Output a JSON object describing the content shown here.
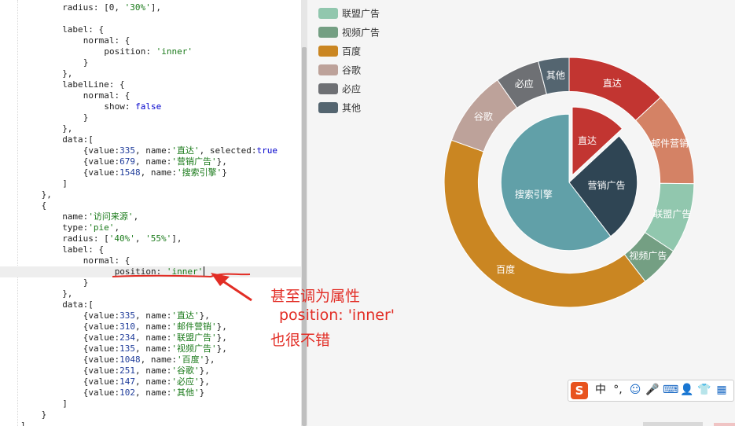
{
  "editor": {
    "lines": [
      {
        "indent": 8,
        "parts": [
          [
            "",
            "radius: [0, "
          ],
          [
            "str",
            "'30%'"
          ],
          [
            "",
            "],"
          ]
        ]
      },
      {
        "indent": 0,
        "parts": []
      },
      {
        "indent": 8,
        "parts": [
          [
            "",
            "label: {"
          ]
        ]
      },
      {
        "indent": 12,
        "parts": [
          [
            "",
            "normal: {"
          ]
        ]
      },
      {
        "indent": 16,
        "parts": [
          [
            "",
            "position: "
          ],
          [
            "str",
            "'inner'"
          ]
        ]
      },
      {
        "indent": 12,
        "parts": [
          [
            "",
            "}"
          ]
        ]
      },
      {
        "indent": 8,
        "parts": [
          [
            "",
            "},"
          ]
        ]
      },
      {
        "indent": 8,
        "parts": [
          [
            "",
            "labelLine: {"
          ]
        ]
      },
      {
        "indent": 12,
        "parts": [
          [
            "",
            "normal: {"
          ]
        ]
      },
      {
        "indent": 16,
        "parts": [
          [
            "",
            "show: "
          ],
          [
            "kw",
            "false"
          ]
        ]
      },
      {
        "indent": 12,
        "parts": [
          [
            "",
            "}"
          ]
        ]
      },
      {
        "indent": 8,
        "parts": [
          [
            "",
            "},"
          ]
        ]
      },
      {
        "indent": 8,
        "parts": [
          [
            "",
            "data:["
          ]
        ]
      },
      {
        "indent": 12,
        "parts": [
          [
            "",
            "{value:"
          ],
          [
            "num",
            "335"
          ],
          [
            "",
            ", name:"
          ],
          [
            "str",
            "'直达'"
          ],
          [
            "",
            ", selected:"
          ],
          [
            "kw",
            "true"
          ]
        ]
      },
      {
        "indent": 12,
        "parts": [
          [
            "",
            "{value:"
          ],
          [
            "num",
            "679"
          ],
          [
            "",
            ", name:"
          ],
          [
            "str",
            "'营销广告'"
          ],
          [
            "",
            "},"
          ]
        ]
      },
      {
        "indent": 12,
        "parts": [
          [
            "",
            "{value:"
          ],
          [
            "num",
            "1548"
          ],
          [
            "",
            ", name:"
          ],
          [
            "str",
            "'搜索引擎'"
          ],
          [
            "",
            "}"
          ]
        ]
      },
      {
        "indent": 8,
        "parts": [
          [
            "",
            "]"
          ]
        ]
      },
      {
        "indent": 4,
        "parts": [
          [
            "",
            "},"
          ]
        ]
      },
      {
        "indent": 4,
        "parts": [
          [
            "",
            "{"
          ]
        ]
      },
      {
        "indent": 8,
        "parts": [
          [
            "",
            "name:"
          ],
          [
            "str",
            "'访问来源'"
          ],
          [
            "",
            ","
          ]
        ]
      },
      {
        "indent": 8,
        "parts": [
          [
            "",
            "type:"
          ],
          [
            "str",
            "'pie'"
          ],
          [
            "",
            ","
          ]
        ]
      },
      {
        "indent": 8,
        "parts": [
          [
            "",
            "radius: ["
          ],
          [
            "str",
            "'40%'"
          ],
          [
            "",
            ", "
          ],
          [
            "str",
            "'55%'"
          ],
          [
            "",
            "],"
          ]
        ]
      },
      {
        "indent": 8,
        "parts": [
          [
            "",
            "label: {"
          ]
        ]
      },
      {
        "indent": 12,
        "parts": [
          [
            "",
            "normal: {"
          ]
        ]
      },
      {
        "indent": 18,
        "parts": [
          [
            "",
            "position: "
          ],
          [
            "str",
            "'inner'"
          ]
        ],
        "highlight": true
      },
      {
        "indent": 12,
        "parts": [
          [
            "",
            "}"
          ]
        ]
      },
      {
        "indent": 8,
        "parts": [
          [
            "",
            "},"
          ]
        ]
      },
      {
        "indent": 8,
        "parts": [
          [
            "",
            "data:["
          ]
        ]
      },
      {
        "indent": 12,
        "parts": [
          [
            "",
            "{value:"
          ],
          [
            "num",
            "335"
          ],
          [
            "",
            ", name:"
          ],
          [
            "str",
            "'直达'"
          ],
          [
            "",
            "},"
          ]
        ]
      },
      {
        "indent": 12,
        "parts": [
          [
            "",
            "{value:"
          ],
          [
            "num",
            "310"
          ],
          [
            "",
            ", name:"
          ],
          [
            "str",
            "'邮件营销'"
          ],
          [
            "",
            "},"
          ]
        ]
      },
      {
        "indent": 12,
        "parts": [
          [
            "",
            "{value:"
          ],
          [
            "num",
            "234"
          ],
          [
            "",
            ", name:"
          ],
          [
            "str",
            "'联盟广告'"
          ],
          [
            "",
            "},"
          ]
        ]
      },
      {
        "indent": 12,
        "parts": [
          [
            "",
            "{value:"
          ],
          [
            "num",
            "135"
          ],
          [
            "",
            ", name:"
          ],
          [
            "str",
            "'视频广告'"
          ],
          [
            "",
            "},"
          ]
        ]
      },
      {
        "indent": 12,
        "parts": [
          [
            "",
            "{value:"
          ],
          [
            "num",
            "1048"
          ],
          [
            "",
            ", name:"
          ],
          [
            "str",
            "'百度'"
          ],
          [
            "",
            "},"
          ]
        ]
      },
      {
        "indent": 12,
        "parts": [
          [
            "",
            "{value:"
          ],
          [
            "num",
            "251"
          ],
          [
            "",
            ", name:"
          ],
          [
            "str",
            "'谷歌'"
          ],
          [
            "",
            "},"
          ]
        ]
      },
      {
        "indent": 12,
        "parts": [
          [
            "",
            "{value:"
          ],
          [
            "num",
            "147"
          ],
          [
            "",
            ", name:"
          ],
          [
            "str",
            "'必应'"
          ],
          [
            "",
            "},"
          ]
        ]
      },
      {
        "indent": 12,
        "parts": [
          [
            "",
            "{value:"
          ],
          [
            "num",
            "102"
          ],
          [
            "",
            ", name:"
          ],
          [
            "str",
            "'其他'"
          ],
          [
            "",
            "}"
          ]
        ]
      },
      {
        "indent": 8,
        "parts": [
          [
            "",
            "]"
          ]
        ]
      },
      {
        "indent": 4,
        "parts": [
          [
            "",
            "}"
          ]
        ]
      },
      {
        "indent": 0,
        "parts": [
          [
            "",
            "]"
          ]
        ]
      }
    ]
  },
  "annotation": {
    "line1": "甚至调为属性",
    "line2": "position: 'inner'",
    "line3": "也很不错",
    "color": "#e22d25"
  },
  "chart_data": {
    "type": "pie",
    "legend": [
      "联盟广告",
      "视频广告",
      "百度",
      "谷歌",
      "必应",
      "其他"
    ],
    "series": [
      {
        "name": "",
        "radius": [
          "0%",
          "30%"
        ],
        "data": [
          {
            "name": "直达",
            "value": 335,
            "selected": true,
            "color": "#c23531"
          },
          {
            "name": "营销广告",
            "value": 679,
            "color": "#2f4554"
          },
          {
            "name": "搜索引擎",
            "value": 1548,
            "color": "#61a0a8"
          }
        ]
      },
      {
        "name": "",
        "radius": [
          "40%",
          "55%"
        ],
        "data": [
          {
            "name": "直达",
            "value": 335,
            "color": "#c23531"
          },
          {
            "name": "邮件营销",
            "value": 310,
            "color": "#d48265"
          },
          {
            "name": "联盟广告",
            "value": 234,
            "color": "#91c7ae"
          },
          {
            "name": "视频广告",
            "value": 135,
            "color": "#749f83"
          },
          {
            "name": "百度",
            "value": 1048,
            "color": "#ca8622"
          },
          {
            "name": "谷歌",
            "value": 251,
            "color": "#bda29a"
          },
          {
            "name": "必应",
            "value": 147,
            "color": "#6e7074"
          },
          {
            "name": "其他",
            "value": 102,
            "color": "#546570"
          }
        ]
      }
    ]
  },
  "ime": {
    "logo": "S",
    "lang": "中",
    "punct": "°,",
    "emoji": "☺",
    "mic": "🎤",
    "keyboard": "⌨",
    "user": "👤",
    "shirt": "👕",
    "grid": "▦"
  }
}
